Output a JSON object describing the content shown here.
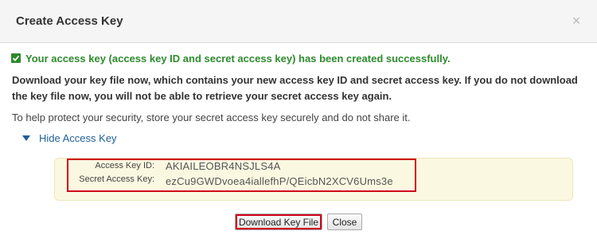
{
  "dialog": {
    "title": "Create Access Key",
    "close_symbol": "×"
  },
  "messages": {
    "success": "Your access key (access key ID and secret access key) has been created successfully.",
    "instruction": "Download your key file now, which contains your new access key ID and secret access key. If you do not download the key file now, you will not be able to retrieve your secret access key again.",
    "protect": "To help protect your security, store your secret access key securely and do not share it."
  },
  "toggle": {
    "label": "Hide Access Key",
    "icon": "triangle-down-icon"
  },
  "keys": {
    "access_key_id_label": "Access Key ID:",
    "access_key_id": "AKIAILEOBR4NSJLS4A",
    "secret_key_label": "Secret Access Key:",
    "secret_key": "ezCu9GWDvoea4iallefhP/QEicbN2XCV6Ums3e"
  },
  "buttons": {
    "download": "Download Key File",
    "close": "Close"
  },
  "colors": {
    "success_green": "#2e8b2e",
    "link_blue": "#1f5f9a",
    "highlight_red": "#d0021b",
    "panel_bg": "#fbf8e1"
  }
}
